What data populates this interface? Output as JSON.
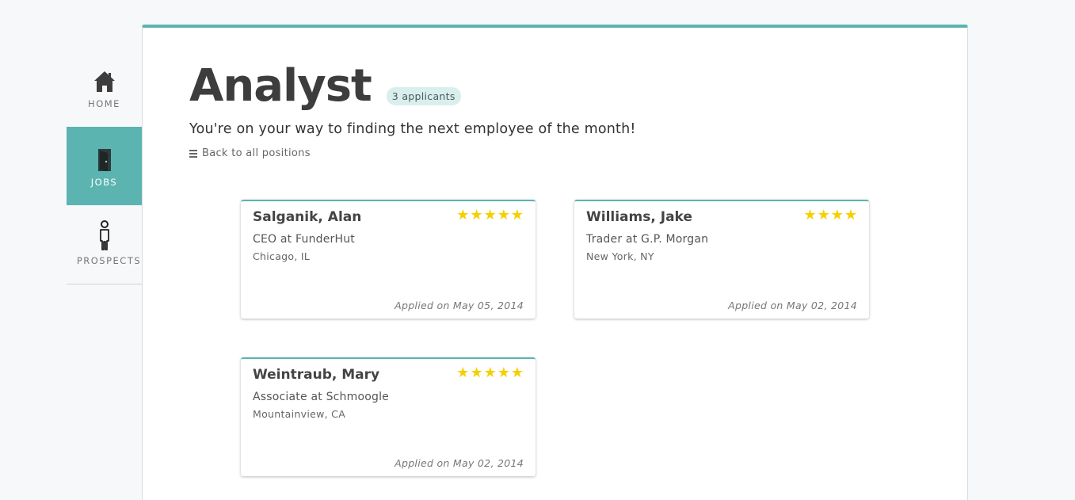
{
  "nav": {
    "items": [
      {
        "label": "HOME",
        "icon": "home-icon"
      },
      {
        "label": "JOBS",
        "icon": "door-icon",
        "active": true
      },
      {
        "label": "PROSPECTS",
        "icon": "person-icon"
      }
    ]
  },
  "job": {
    "title": "Analyst",
    "applicant_count": "3 applicants",
    "subtitle": "You're on your way to finding the next employee of the month!",
    "back_link": "Back to all positions"
  },
  "applicants": [
    {
      "name": "Salganik, Alan",
      "role": "CEO at FunderHut",
      "location": "Chicago, IL",
      "applied": "Applied on May 05, 2014",
      "rating": 5
    },
    {
      "name": "Williams, Jake",
      "role": "Trader at G.P. Morgan",
      "location": "New York, NY",
      "applied": "Applied on May 02, 2014",
      "rating": 4
    },
    {
      "name": "Weintraub, Mary",
      "role": "Associate at Schmoogle",
      "location": "Mountainview, CA",
      "applied": "Applied on May 02, 2014",
      "rating": 5
    }
  ],
  "colors": {
    "accent": "#5bb4b0",
    "star": "#f5d000",
    "badge_bg": "#d9efee"
  }
}
